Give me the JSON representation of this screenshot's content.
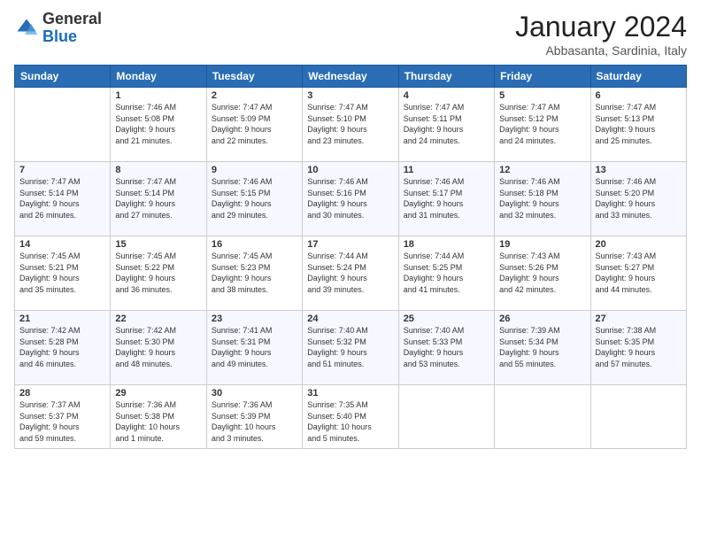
{
  "logo": {
    "general": "General",
    "blue": "Blue"
  },
  "header": {
    "month": "January 2024",
    "location": "Abbasanta, Sardinia, Italy"
  },
  "weekdays": [
    "Sunday",
    "Monday",
    "Tuesday",
    "Wednesday",
    "Thursday",
    "Friday",
    "Saturday"
  ],
  "weeks": [
    [
      {
        "day": "",
        "info": ""
      },
      {
        "day": "1",
        "info": "Sunrise: 7:46 AM\nSunset: 5:08 PM\nDaylight: 9 hours\nand 21 minutes."
      },
      {
        "day": "2",
        "info": "Sunrise: 7:47 AM\nSunset: 5:09 PM\nDaylight: 9 hours\nand 22 minutes."
      },
      {
        "day": "3",
        "info": "Sunrise: 7:47 AM\nSunset: 5:10 PM\nDaylight: 9 hours\nand 23 minutes."
      },
      {
        "day": "4",
        "info": "Sunrise: 7:47 AM\nSunset: 5:11 PM\nDaylight: 9 hours\nand 24 minutes."
      },
      {
        "day": "5",
        "info": "Sunrise: 7:47 AM\nSunset: 5:12 PM\nDaylight: 9 hours\nand 24 minutes."
      },
      {
        "day": "6",
        "info": "Sunrise: 7:47 AM\nSunset: 5:13 PM\nDaylight: 9 hours\nand 25 minutes."
      }
    ],
    [
      {
        "day": "7",
        "info": "Sunrise: 7:47 AM\nSunset: 5:14 PM\nDaylight: 9 hours\nand 26 minutes."
      },
      {
        "day": "8",
        "info": "Sunrise: 7:47 AM\nSunset: 5:14 PM\nDaylight: 9 hours\nand 27 minutes."
      },
      {
        "day": "9",
        "info": "Sunrise: 7:46 AM\nSunset: 5:15 PM\nDaylight: 9 hours\nand 29 minutes."
      },
      {
        "day": "10",
        "info": "Sunrise: 7:46 AM\nSunset: 5:16 PM\nDaylight: 9 hours\nand 30 minutes."
      },
      {
        "day": "11",
        "info": "Sunrise: 7:46 AM\nSunset: 5:17 PM\nDaylight: 9 hours\nand 31 minutes."
      },
      {
        "day": "12",
        "info": "Sunrise: 7:46 AM\nSunset: 5:18 PM\nDaylight: 9 hours\nand 32 minutes."
      },
      {
        "day": "13",
        "info": "Sunrise: 7:46 AM\nSunset: 5:20 PM\nDaylight: 9 hours\nand 33 minutes."
      }
    ],
    [
      {
        "day": "14",
        "info": "Sunrise: 7:45 AM\nSunset: 5:21 PM\nDaylight: 9 hours\nand 35 minutes."
      },
      {
        "day": "15",
        "info": "Sunrise: 7:45 AM\nSunset: 5:22 PM\nDaylight: 9 hours\nand 36 minutes."
      },
      {
        "day": "16",
        "info": "Sunrise: 7:45 AM\nSunset: 5:23 PM\nDaylight: 9 hours\nand 38 minutes."
      },
      {
        "day": "17",
        "info": "Sunrise: 7:44 AM\nSunset: 5:24 PM\nDaylight: 9 hours\nand 39 minutes."
      },
      {
        "day": "18",
        "info": "Sunrise: 7:44 AM\nSunset: 5:25 PM\nDaylight: 9 hours\nand 41 minutes."
      },
      {
        "day": "19",
        "info": "Sunrise: 7:43 AM\nSunset: 5:26 PM\nDaylight: 9 hours\nand 42 minutes."
      },
      {
        "day": "20",
        "info": "Sunrise: 7:43 AM\nSunset: 5:27 PM\nDaylight: 9 hours\nand 44 minutes."
      }
    ],
    [
      {
        "day": "21",
        "info": "Sunrise: 7:42 AM\nSunset: 5:28 PM\nDaylight: 9 hours\nand 46 minutes."
      },
      {
        "day": "22",
        "info": "Sunrise: 7:42 AM\nSunset: 5:30 PM\nDaylight: 9 hours\nand 48 minutes."
      },
      {
        "day": "23",
        "info": "Sunrise: 7:41 AM\nSunset: 5:31 PM\nDaylight: 9 hours\nand 49 minutes."
      },
      {
        "day": "24",
        "info": "Sunrise: 7:40 AM\nSunset: 5:32 PM\nDaylight: 9 hours\nand 51 minutes."
      },
      {
        "day": "25",
        "info": "Sunrise: 7:40 AM\nSunset: 5:33 PM\nDaylight: 9 hours\nand 53 minutes."
      },
      {
        "day": "26",
        "info": "Sunrise: 7:39 AM\nSunset: 5:34 PM\nDaylight: 9 hours\nand 55 minutes."
      },
      {
        "day": "27",
        "info": "Sunrise: 7:38 AM\nSunset: 5:35 PM\nDaylight: 9 hours\nand 57 minutes."
      }
    ],
    [
      {
        "day": "28",
        "info": "Sunrise: 7:37 AM\nSunset: 5:37 PM\nDaylight: 9 hours\nand 59 minutes."
      },
      {
        "day": "29",
        "info": "Sunrise: 7:36 AM\nSunset: 5:38 PM\nDaylight: 10 hours\nand 1 minute."
      },
      {
        "day": "30",
        "info": "Sunrise: 7:36 AM\nSunset: 5:39 PM\nDaylight: 10 hours\nand 3 minutes."
      },
      {
        "day": "31",
        "info": "Sunrise: 7:35 AM\nSunset: 5:40 PM\nDaylight: 10 hours\nand 5 minutes."
      },
      {
        "day": "",
        "info": ""
      },
      {
        "day": "",
        "info": ""
      },
      {
        "day": "",
        "info": ""
      }
    ]
  ]
}
